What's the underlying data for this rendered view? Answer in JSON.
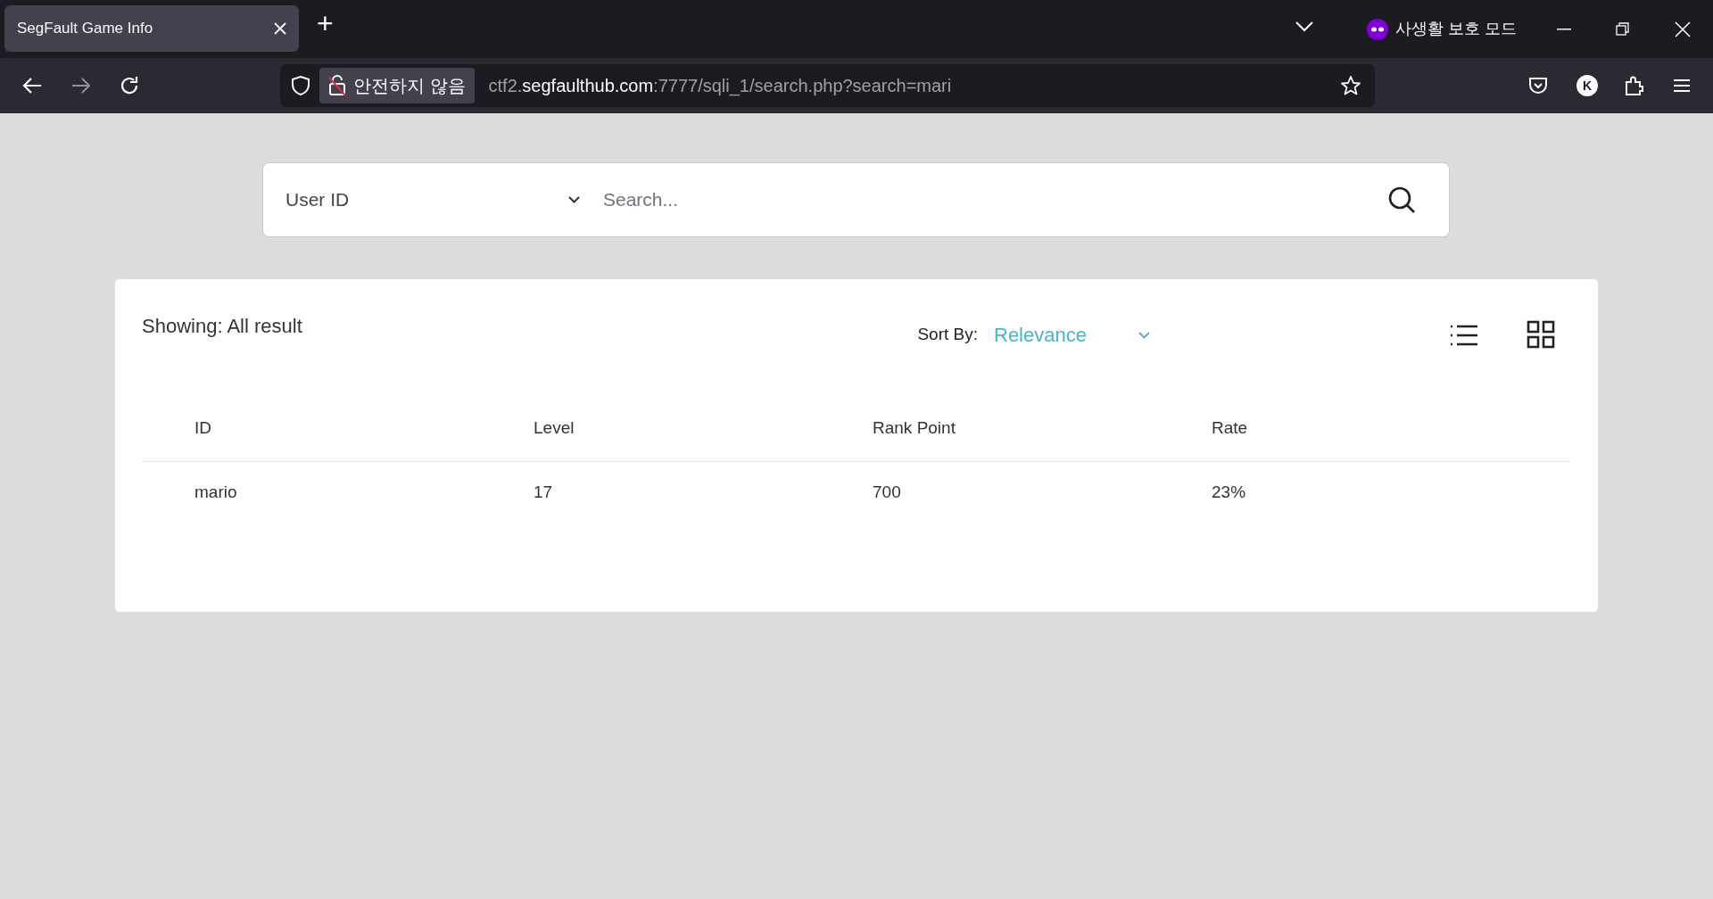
{
  "browser": {
    "tab": {
      "title": "SegFault Game Info",
      "selected": true
    },
    "new_tab": "+",
    "private_label": "사생활 보호 모드",
    "security_label": "안전하지 않음",
    "url": {
      "prefix": "ctf2.",
      "domain": "segfaulthub.com",
      "rest": ":7777/sqli_1/search.php?search=mari"
    },
    "account_initial": "K"
  },
  "search": {
    "field_select": "User ID",
    "placeholder": "Search..."
  },
  "results": {
    "showing": "Showing: All result",
    "sort_label": "Sort By:",
    "sort_value": "Relevance",
    "view_modes": [
      {
        "kind": "list",
        "selected": false
      },
      {
        "kind": "grid",
        "selected": false
      }
    ],
    "columns": [
      "ID",
      "Level",
      "Rank Point",
      "Rate"
    ],
    "rows": [
      [
        "mario",
        "17",
        "700",
        "23%"
      ]
    ]
  }
}
